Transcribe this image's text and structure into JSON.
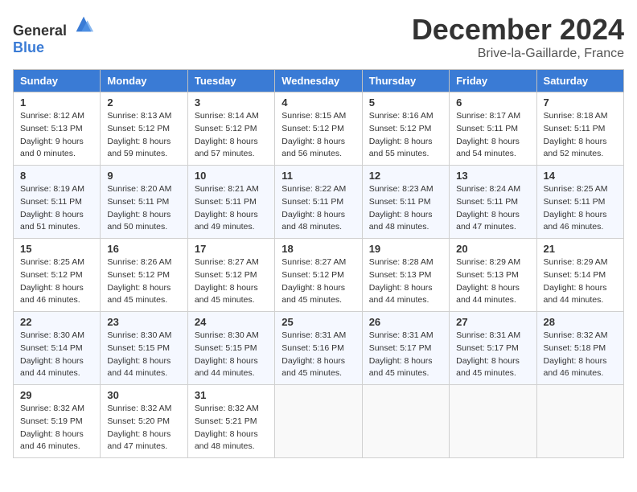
{
  "logo": {
    "general": "General",
    "blue": "Blue"
  },
  "title": "December 2024",
  "location": "Brive-la-Gaillarde, France",
  "days_of_week": [
    "Sunday",
    "Monday",
    "Tuesday",
    "Wednesday",
    "Thursday",
    "Friday",
    "Saturday"
  ],
  "weeks": [
    [
      {
        "day": "1",
        "sunrise": "8:12 AM",
        "sunset": "5:13 PM",
        "daylight": "9 hours and 0 minutes."
      },
      {
        "day": "2",
        "sunrise": "8:13 AM",
        "sunset": "5:12 PM",
        "daylight": "8 hours and 59 minutes."
      },
      {
        "day": "3",
        "sunrise": "8:14 AM",
        "sunset": "5:12 PM",
        "daylight": "8 hours and 57 minutes."
      },
      {
        "day": "4",
        "sunrise": "8:15 AM",
        "sunset": "5:12 PM",
        "daylight": "8 hours and 56 minutes."
      },
      {
        "day": "5",
        "sunrise": "8:16 AM",
        "sunset": "5:12 PM",
        "daylight": "8 hours and 55 minutes."
      },
      {
        "day": "6",
        "sunrise": "8:17 AM",
        "sunset": "5:11 PM",
        "daylight": "8 hours and 54 minutes."
      },
      {
        "day": "7",
        "sunrise": "8:18 AM",
        "sunset": "5:11 PM",
        "daylight": "8 hours and 52 minutes."
      }
    ],
    [
      {
        "day": "8",
        "sunrise": "8:19 AM",
        "sunset": "5:11 PM",
        "daylight": "8 hours and 51 minutes."
      },
      {
        "day": "9",
        "sunrise": "8:20 AM",
        "sunset": "5:11 PM",
        "daylight": "8 hours and 50 minutes."
      },
      {
        "day": "10",
        "sunrise": "8:21 AM",
        "sunset": "5:11 PM",
        "daylight": "8 hours and 49 minutes."
      },
      {
        "day": "11",
        "sunrise": "8:22 AM",
        "sunset": "5:11 PM",
        "daylight": "8 hours and 48 minutes."
      },
      {
        "day": "12",
        "sunrise": "8:23 AM",
        "sunset": "5:11 PM",
        "daylight": "8 hours and 48 minutes."
      },
      {
        "day": "13",
        "sunrise": "8:24 AM",
        "sunset": "5:11 PM",
        "daylight": "8 hours and 47 minutes."
      },
      {
        "day": "14",
        "sunrise": "8:25 AM",
        "sunset": "5:11 PM",
        "daylight": "8 hours and 46 minutes."
      }
    ],
    [
      {
        "day": "15",
        "sunrise": "8:25 AM",
        "sunset": "5:12 PM",
        "daylight": "8 hours and 46 minutes."
      },
      {
        "day": "16",
        "sunrise": "8:26 AM",
        "sunset": "5:12 PM",
        "daylight": "8 hours and 45 minutes."
      },
      {
        "day": "17",
        "sunrise": "8:27 AM",
        "sunset": "5:12 PM",
        "daylight": "8 hours and 45 minutes."
      },
      {
        "day": "18",
        "sunrise": "8:27 AM",
        "sunset": "5:12 PM",
        "daylight": "8 hours and 45 minutes."
      },
      {
        "day": "19",
        "sunrise": "8:28 AM",
        "sunset": "5:13 PM",
        "daylight": "8 hours and 44 minutes."
      },
      {
        "day": "20",
        "sunrise": "8:29 AM",
        "sunset": "5:13 PM",
        "daylight": "8 hours and 44 minutes."
      },
      {
        "day": "21",
        "sunrise": "8:29 AM",
        "sunset": "5:14 PM",
        "daylight": "8 hours and 44 minutes."
      }
    ],
    [
      {
        "day": "22",
        "sunrise": "8:30 AM",
        "sunset": "5:14 PM",
        "daylight": "8 hours and 44 minutes."
      },
      {
        "day": "23",
        "sunrise": "8:30 AM",
        "sunset": "5:15 PM",
        "daylight": "8 hours and 44 minutes."
      },
      {
        "day": "24",
        "sunrise": "8:30 AM",
        "sunset": "5:15 PM",
        "daylight": "8 hours and 44 minutes."
      },
      {
        "day": "25",
        "sunrise": "8:31 AM",
        "sunset": "5:16 PM",
        "daylight": "8 hours and 45 minutes."
      },
      {
        "day": "26",
        "sunrise": "8:31 AM",
        "sunset": "5:17 PM",
        "daylight": "8 hours and 45 minutes."
      },
      {
        "day": "27",
        "sunrise": "8:31 AM",
        "sunset": "5:17 PM",
        "daylight": "8 hours and 45 minutes."
      },
      {
        "day": "28",
        "sunrise": "8:32 AM",
        "sunset": "5:18 PM",
        "daylight": "8 hours and 46 minutes."
      }
    ],
    [
      {
        "day": "29",
        "sunrise": "8:32 AM",
        "sunset": "5:19 PM",
        "daylight": "8 hours and 46 minutes."
      },
      {
        "day": "30",
        "sunrise": "8:32 AM",
        "sunset": "5:20 PM",
        "daylight": "8 hours and 47 minutes."
      },
      {
        "day": "31",
        "sunrise": "8:32 AM",
        "sunset": "5:21 PM",
        "daylight": "8 hours and 48 minutes."
      },
      null,
      null,
      null,
      null
    ]
  ]
}
